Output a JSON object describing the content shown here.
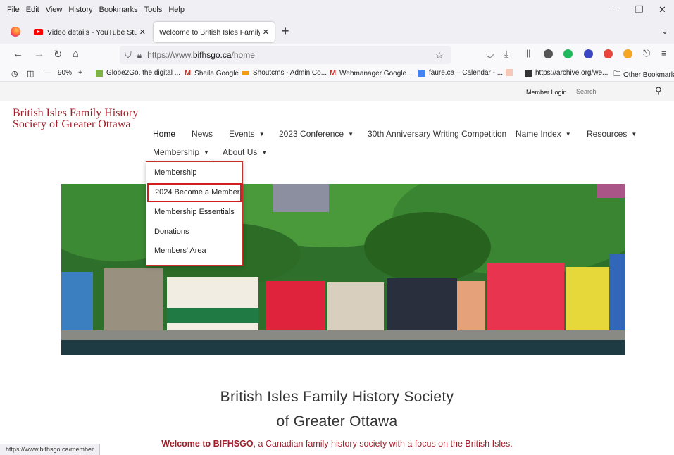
{
  "menubar": {
    "items": [
      {
        "u": "F",
        "rest": "ile"
      },
      {
        "u": "E",
        "rest": "dit"
      },
      {
        "u": "V",
        "rest": "iew"
      },
      {
        "pre": "Hi",
        "u": "s",
        "rest": "tory"
      },
      {
        "u": "B",
        "rest": "ookmarks"
      },
      {
        "u": "T",
        "rest": "ools"
      },
      {
        "u": "H",
        "rest": "elp"
      }
    ],
    "window_controls": [
      "–",
      "❐",
      "✕"
    ]
  },
  "tabs": [
    {
      "title": "Video details - YouTube Studio",
      "close": "✕"
    },
    {
      "title": "Welcome to British Isles Family Histo",
      "close": "✕"
    }
  ],
  "tabbar": {
    "new_tab": "+",
    "list_all": "⌄"
  },
  "navbar": {
    "url_prefix": "https://www.",
    "url_domain": "bifhsgo.ca",
    "url_path": "/home"
  },
  "bookmarks": {
    "zoom": "90%",
    "items": [
      "Globe2Go, the digital ...",
      "Sheila Google",
      "Shoutcms - Admin Co...",
      "Webmanager Google ...",
      "faure.ca – Calendar - ...",
      "https://archive.org/we...",
      "Other Bookmarks"
    ]
  },
  "site": {
    "member_login": "Member Login",
    "search_placeholder": "Search",
    "logo_line1": "British Isles Family History",
    "logo_line2": "Society of Greater Ottawa",
    "nav": [
      "Home",
      "News",
      "Events",
      "2023 Conference",
      "30th Anniversary Writing Competition",
      "Name Index",
      "Resources",
      "Membership",
      "About Us"
    ],
    "dropdown": [
      "Membership",
      "2024 Become a Member",
      "Membership Essentials",
      "Donations",
      "Members' Area"
    ],
    "heading_line1": "British Isles Family History Society",
    "heading_line2": "of Greater Ottawa",
    "welcome_bold": "Welcome to BIFHSGO",
    "welcome_rest": ", a Canadian family history society with a focus on the British Isles."
  },
  "status_url": "https://www.bifhsgo.ca/member",
  "colors": {
    "brand": "#a01e2a",
    "dropdown_highlight": "#d11f1f"
  }
}
